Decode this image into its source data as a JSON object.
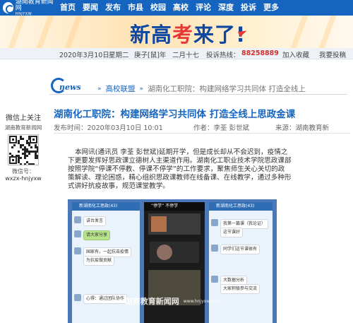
{
  "site": {
    "logo_cn": "湖南教育新闻网",
    "logo_en": "HNJYXW"
  },
  "nav": {
    "items": [
      "首页",
      "要闻",
      "发布",
      "市县",
      "校园",
      "高校",
      "评论",
      "深度",
      "投诉",
      "更多"
    ]
  },
  "banner": {
    "text_before": "新高",
    "text_highlight": "考",
    "text_after": "来了!"
  },
  "datebar": {
    "date": "2020年3月10日",
    "weekday": "星期二",
    "lunar_year": "庚子[鼠]年",
    "lunar_date": "二月十七",
    "hotline_label": "投诉热线：",
    "hotline_number": "88258889",
    "bookmark": "加入收藏",
    "submit": "我要投稿"
  },
  "breadcrumb": {
    "logo_text": "news",
    "section": "高校联盟",
    "current": "湖南化工职院：构建网络学习共同体 打造全线上"
  },
  "sidebar": {
    "title": "微信上关注",
    "subtitle": "湖南教育新闻网",
    "id_label": "微信号：",
    "id_value": "wxzx-hnjyxw"
  },
  "article": {
    "title": "湖南化工职院：构建网络学习共同体 打造全线上思政金课",
    "published": "发布时间：2020年03月10日 10:01",
    "author": "作者：李荃 彭世斌",
    "source": "来源：湖南教育新",
    "paragraph_lines": [
      "本网讯(通讯员 李荃 彭世斌)延期开学，但是成长却从不会迟到，疫情之",
      "下更要发挥好思政课立德树人主渠道作用。湖南化工职业技术学院思政课部",
      "按照学院“停课不停教、停课不停学”的工作要求，聚焦师生关心关切的政",
      "策解读、理论困惑，精心组织思政课教师在线备课、在线教学，通过多种形",
      "式讲好抗疫故事，规范课堂教学。"
    ]
  },
  "photo": {
    "watermark_cn": "湖南教育新闻网",
    "watermark_en": "www.hnjyxw.com",
    "phone1_header": "新湖南化工思政(43)",
    "phone1_msgs": [
      "讲台发言",
      "请大家分享",
      "国家有，一起抗击疫情",
      "为抗疫做贡献",
      "心得：通过团队协作"
    ],
    "phone2_header": "“停学” 不停学",
    "phone3_header": "新湖南化工思政(43)",
    "phone3_msgs": [
      "我第一篇课（我论证）",
      "这节课好",
      "同学们这节课很有",
      "大数据分析",
      "大家积极参与交流"
    ]
  }
}
